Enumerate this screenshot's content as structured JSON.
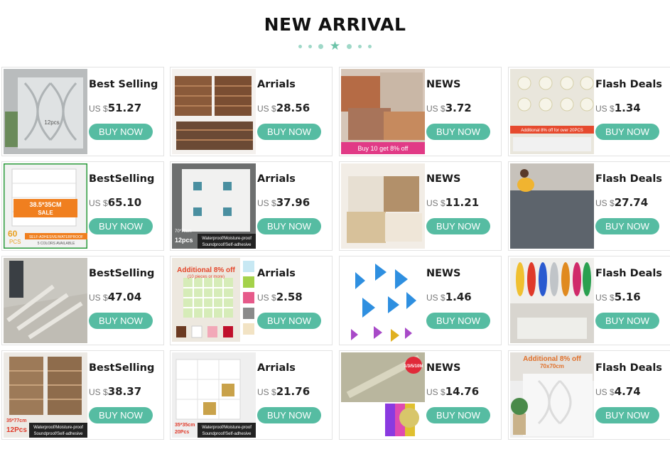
{
  "header": {
    "title": "NEW ARRIVAL"
  },
  "products": [
    {
      "category": "Best Selling",
      "currency": "US $",
      "price": "51.27",
      "button": "BUY NOW",
      "image_labels": [
        "12pcs"
      ]
    },
    {
      "category": "Arrials",
      "currency": "US $",
      "price": "28.56",
      "button": "BUY NOW",
      "image_labels": []
    },
    {
      "category": "NEWS",
      "currency": "US $",
      "price": "3.72",
      "button": "BUY NOW",
      "image_labels": [
        "Buy 10 get 8% off"
      ]
    },
    {
      "category": "Flash Deals",
      "currency": "US $",
      "price": "1.34",
      "button": "BUY NOW",
      "image_labels": [
        "Additional 8% off for over 20PCS"
      ]
    },
    {
      "category": "BestSelling",
      "currency": "US $",
      "price": "65.10",
      "button": "BUY NOW",
      "image_labels": [
        "38.5*35CM",
        "SALE",
        "60",
        "PCS",
        "SELF-ADHESIVE/WATERPROOF",
        "5 COLORS AVAILABLE"
      ]
    },
    {
      "category": "Arrials",
      "currency": "US $",
      "price": "37.96",
      "button": "BUY NOW",
      "image_labels": [
        "70*70cm",
        "12pcs",
        "Waterproof/Moisture-proof",
        "Soundproof/Self-adhesive"
      ]
    },
    {
      "category": "NEWS",
      "currency": "US $",
      "price": "11.21",
      "button": "BUY NOW",
      "image_labels": []
    },
    {
      "category": "Flash Deals",
      "currency": "US $",
      "price": "27.74",
      "button": "BUY NOW",
      "image_labels": []
    },
    {
      "category": "BestSelling",
      "currency": "US $",
      "price": "47.04",
      "button": "BUY NOW",
      "image_labels": []
    },
    {
      "category": "Arrials",
      "currency": "US $",
      "price": "2.58",
      "button": "BUY NOW",
      "image_labels": [
        "Additional 8% off",
        "(10 pieces or more)"
      ]
    },
    {
      "category": "NEWS",
      "currency": "US $",
      "price": "1.46",
      "button": "BUY NOW",
      "image_labels": []
    },
    {
      "category": "Flash Deals",
      "currency": "US $",
      "price": "5.16",
      "button": "BUY NOW",
      "image_labels": []
    },
    {
      "category": "BestSelling",
      "currency": "US $",
      "price": "38.37",
      "button": "BUY NOW",
      "image_labels": [
        "35*77cm",
        "12Pcs",
        "Waterproof/Moisture-proof",
        "Soundproof/Self-adhesive"
      ]
    },
    {
      "category": "Arrials",
      "currency": "US $",
      "price": "21.76",
      "button": "BUY NOW",
      "image_labels": [
        "35*35cm",
        "20Pcs",
        "Waterproof/Moisture-proof",
        "Soundproof/Self-adhesive"
      ]
    },
    {
      "category": "NEWS",
      "currency": "US $",
      "price": "14.76",
      "button": "BUY NOW",
      "image_labels": [
        "1/3/5/10M"
      ]
    },
    {
      "category": "Flash Deals",
      "currency": "US $",
      "price": "4.74",
      "button": "BUY NOW",
      "image_labels": [
        "Additional 8% off",
        "70x70cm"
      ]
    }
  ],
  "icons": {
    "divider": "star-icon"
  },
  "colors": {
    "accent": "#56bca2",
    "dot": "#9fd8c8",
    "star": "#6cc3a8"
  }
}
